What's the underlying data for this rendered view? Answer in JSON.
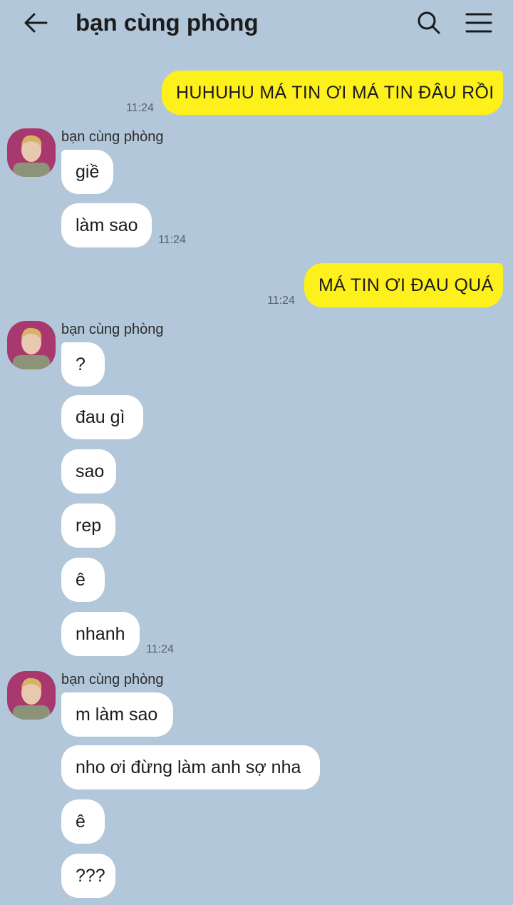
{
  "header": {
    "title": "bạn cùng phòng",
    "back_icon": "arrow-left-icon",
    "search_icon": "search-icon",
    "menu_icon": "menu-icon"
  },
  "colors": {
    "background": "#b2c7d9",
    "outgoing_bubble": "#fef01b",
    "incoming_bubble": "#ffffff"
  },
  "messages": [
    {
      "text": "HUHUHU MÁ TIN ƠI MÁ TIN ĐÂU RỒI",
      "time": "11:24"
    },
    {
      "sender": "bạn cùng phòng"
    },
    {
      "text": "giề"
    },
    {
      "text": "làm sao",
      "time": "11:24"
    },
    {
      "text": "MÁ TIN ƠI ĐAU QUÁ",
      "time": "11:24"
    },
    {
      "sender": "bạn cùng phòng"
    },
    {
      "text": "?"
    },
    {
      "text": "đau gì"
    },
    {
      "text": "sao"
    },
    {
      "text": "rep"
    },
    {
      "text": "ê"
    },
    {
      "text": "nhanh",
      "time": "11:24"
    },
    {
      "sender": "bạn cùng phòng"
    },
    {
      "text": "m làm sao"
    },
    {
      "text": "nho ơi đừng làm anh sợ nha"
    },
    {
      "text": "ê"
    },
    {
      "text": "???"
    }
  ]
}
